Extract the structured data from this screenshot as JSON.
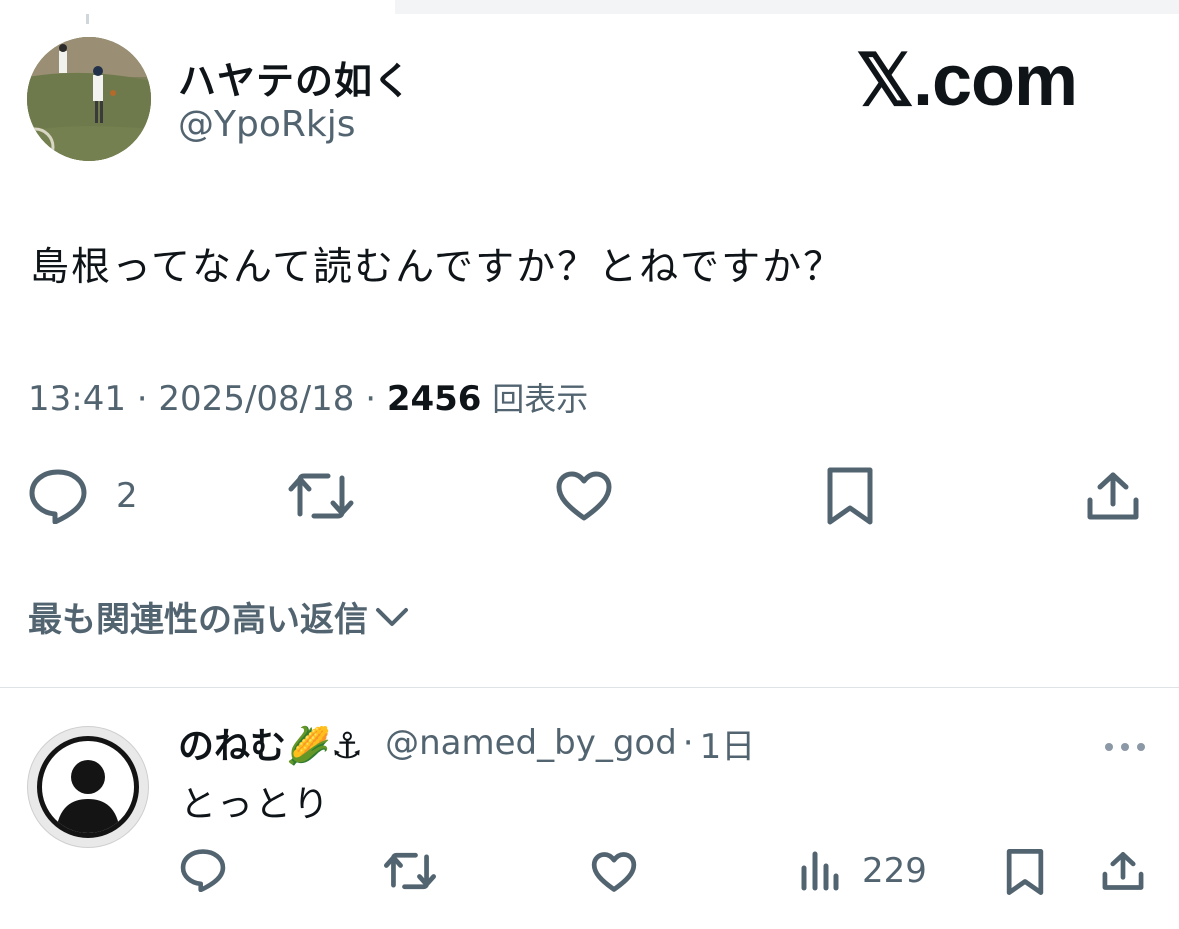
{
  "tweet": {
    "display_name": "ハヤテの如く",
    "handle": "@YpoRkjs",
    "logo_text": "𝕏.com",
    "text": "島根ってなんて読むんですか？とねですか？",
    "time": "13:41",
    "date": "2025/08/18",
    "views_count": "2456",
    "views_label": "回表示",
    "reply_count": "2"
  },
  "sort": {
    "label": "最も関連性の高い返信"
  },
  "reply": {
    "display_name": "のねむ🌽⚓",
    "handle": "@named_by_god",
    "time": "1日",
    "text": "とっとり",
    "views_count": "229"
  },
  "colors": {
    "text_primary": "#0f1419",
    "text_secondary": "#536471",
    "divider": "#dfe3e6"
  },
  "icons": {
    "reply": "speech-bubble-icon",
    "retweet": "retweet-icon",
    "like": "heart-icon",
    "bookmark": "bookmark-icon",
    "share": "share-icon",
    "views": "bar-chart-icon",
    "more": "more-dots-icon",
    "sort": "chevron-down-icon"
  }
}
